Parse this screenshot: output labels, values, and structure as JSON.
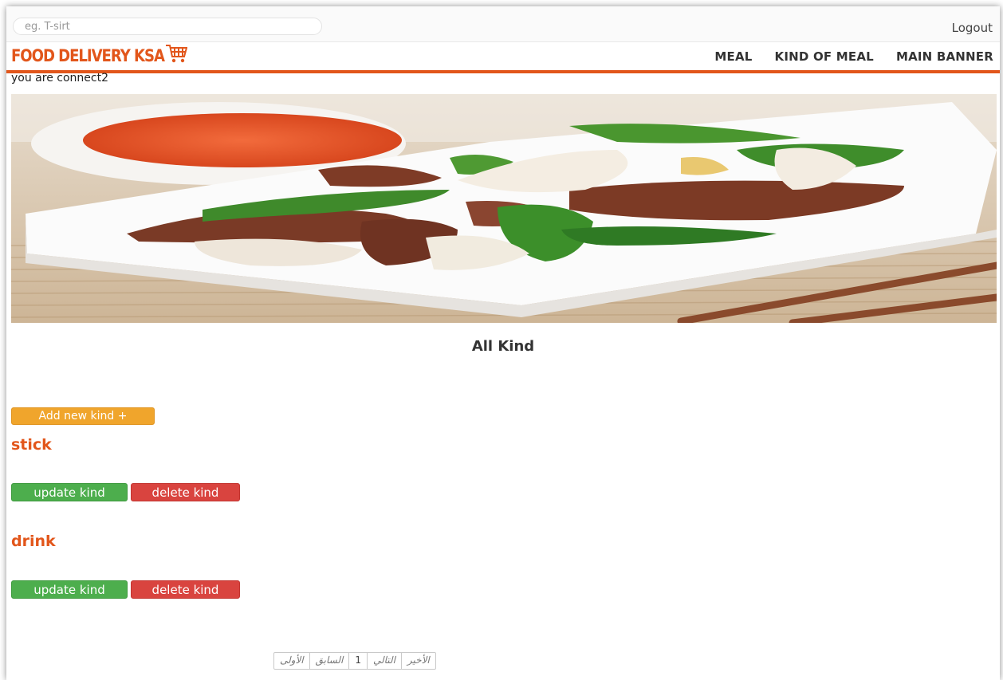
{
  "search": {
    "placeholder": "eg. T-sirt"
  },
  "header": {
    "logout_label": "Logout",
    "logo_text": "FOOD DELIVERY KSA",
    "nav": [
      "MEAL",
      "KIND OF MEAL",
      "MAIN BANNER"
    ]
  },
  "status_text": "you are connect2",
  "main": {
    "heading": "All Kind",
    "add_button": "Add new kind +",
    "kinds": [
      {
        "name": "stick",
        "update_label": "update kind",
        "delete_label": "delete kind"
      },
      {
        "name": "drink",
        "update_label": "update kind",
        "delete_label": "delete kind"
      }
    ]
  },
  "pagination": {
    "first": "الأولى",
    "prev": "السابق",
    "current": "1",
    "next": "التالي",
    "last": "الأخير"
  },
  "colors": {
    "brand": "#e2561b",
    "add_button": "#f0a52c",
    "update_button": "#4dae4d",
    "delete_button": "#d9443f"
  },
  "icons": {
    "logo_cart": "cart-icon"
  }
}
